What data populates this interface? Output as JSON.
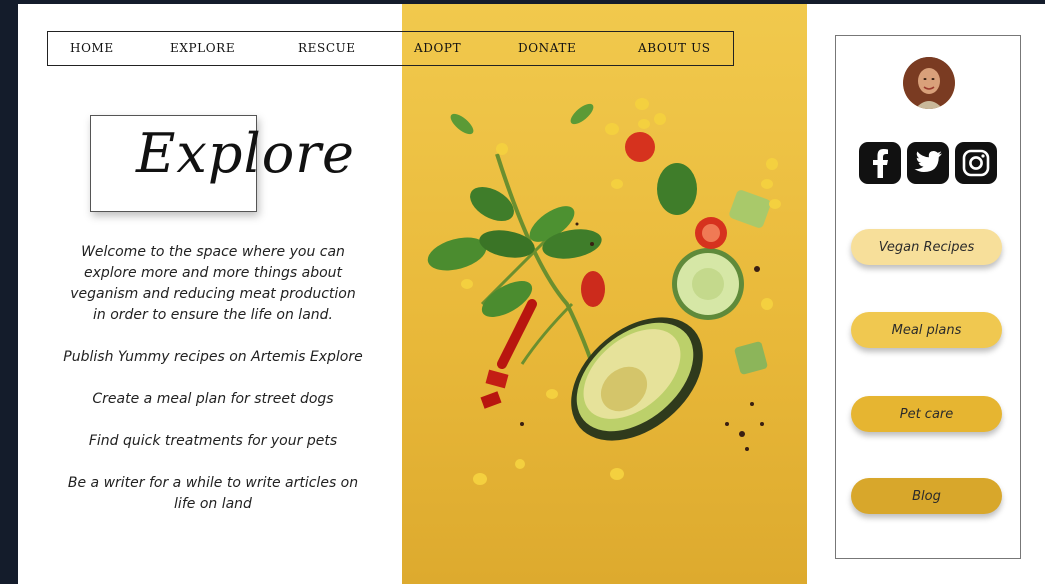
{
  "nav": {
    "items": [
      "HOME",
      "EXPLORE",
      "RESCUE",
      "ADOPT",
      "DONATE",
      "ABOUT US"
    ]
  },
  "page": {
    "title": "Explore",
    "intro": "Welcome to the space where you can explore more and more things about veganism and reducing meat production in order to ensure the life on land.",
    "lines": [
      "Publish Yummy recipes on Artemis Explore",
      "Create a meal plan for street dogs",
      "Find quick treatments for your pets",
      "Be a writer for a while to write articles on life on land"
    ]
  },
  "sidebar": {
    "social_icons": [
      "facebook-icon",
      "twitter-icon",
      "instagram-icon"
    ],
    "buttons": [
      "Vegan Recipes",
      "Meal plans",
      "Pet care",
      "Blog"
    ]
  },
  "colors": {
    "background": "#141c2b",
    "hero_yellow": "#ecbe42",
    "pill_1": "#f7df9a",
    "pill_2": "#f0c850",
    "pill_3": "#e6b531",
    "pill_4": "#d8a72b"
  }
}
